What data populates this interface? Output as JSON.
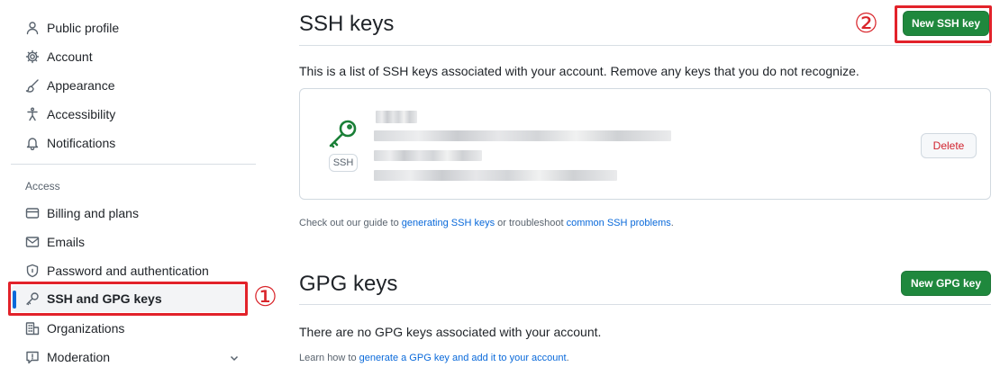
{
  "sidebar": {
    "items": [
      {
        "label": "Public profile",
        "icon": "person-icon"
      },
      {
        "label": "Account",
        "icon": "gear-icon"
      },
      {
        "label": "Appearance",
        "icon": "paintbrush-icon"
      },
      {
        "label": "Accessibility",
        "icon": "accessibility-icon"
      },
      {
        "label": "Notifications",
        "icon": "bell-icon"
      }
    ],
    "access_label": "Access",
    "access_items": [
      {
        "label": "Billing and plans",
        "icon": "credit-card-icon"
      },
      {
        "label": "Emails",
        "icon": "mail-icon"
      },
      {
        "label": "Password and authentication",
        "icon": "shield-lock-icon"
      },
      {
        "label": "SSH and GPG keys",
        "icon": "key-icon",
        "active": true
      },
      {
        "label": "Organizations",
        "icon": "organization-icon"
      },
      {
        "label": "Moderation",
        "icon": "report-icon"
      }
    ]
  },
  "annotations": {
    "marker_1": "①",
    "marker_2": "②",
    "highlight_color": "#e2222a"
  },
  "ssh": {
    "title": "SSH keys",
    "new_button": "New SSH key",
    "description": "This is a list of SSH keys associated with your account. Remove any keys that you do not recognize.",
    "key": {
      "badge": "SSH",
      "delete_label": "Delete"
    },
    "guide": {
      "prefix": "Check out our guide to ",
      "link1": "generating SSH keys",
      "middle": " or troubleshoot ",
      "link2": "common SSH problems",
      "suffix": "."
    }
  },
  "gpg": {
    "title": "GPG keys",
    "new_button": "New GPG key",
    "empty_text": "There are no GPG keys associated with your account.",
    "learn": {
      "prefix": "Learn how to ",
      "link": "generate a GPG key and add it to your account",
      "suffix": "."
    }
  },
  "colors": {
    "accent_green": "#1f883d",
    "link_blue": "#0969da",
    "danger_red": "#d1242f",
    "active_bar": "#0969da"
  }
}
